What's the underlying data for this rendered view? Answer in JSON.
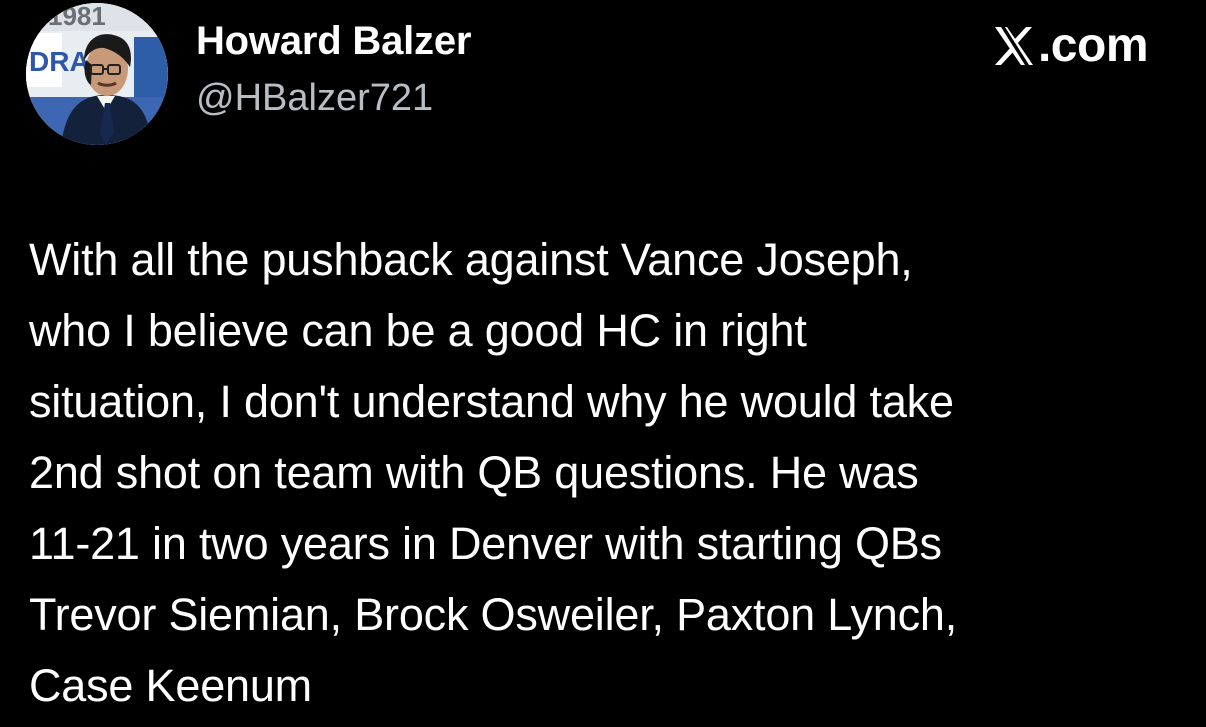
{
  "tweet": {
    "author": {
      "display_name": "Howard Balzer",
      "handle": "@HBalzer721",
      "avatar_text_top": "1981",
      "avatar_text_side": "DRA"
    },
    "brand": {
      "icon": "x-logo-icon",
      "suffix": ".com"
    },
    "body": "With all the pushback against Vance Joseph,\nwho I believe can be a good HC in right\nsituation, I don't understand why he would take\n2nd shot on team with QB questions. He was\n11-21 in two years in Denver with starting QBs\nTrevor Siemian, Brock Osweiler, Paxton Lynch,\nCase Keenum"
  },
  "colors": {
    "background": "#000000",
    "text_primary": "#ffffff",
    "text_secondary": "#b8bec4"
  }
}
